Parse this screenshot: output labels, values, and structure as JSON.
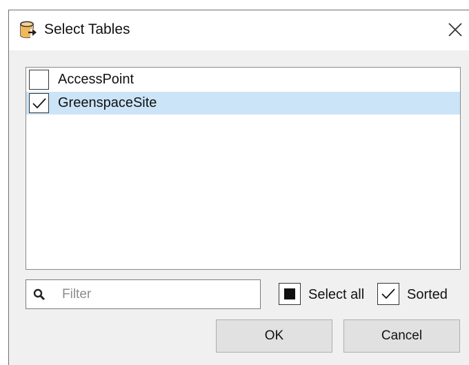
{
  "dialog": {
    "title": "Select Tables",
    "title_icon": "database-export-icon",
    "close_icon": "close-icon"
  },
  "tables": {
    "items": [
      {
        "label": "AccessPoint",
        "checked": false,
        "selected": false
      },
      {
        "label": "GreenspaceSite",
        "checked": true,
        "selected": true
      }
    ]
  },
  "filter": {
    "placeholder": "Filter",
    "value": "",
    "icon": "search-icon"
  },
  "options": {
    "select_all_label": "Select all",
    "select_all_state": "indeterminate",
    "sorted_label": "Sorted",
    "sorted_checked": true
  },
  "buttons": {
    "ok_label": "OK",
    "cancel_label": "Cancel"
  },
  "colors": {
    "selection": "#cce4f7",
    "icon_accent": "#f0b85a"
  }
}
